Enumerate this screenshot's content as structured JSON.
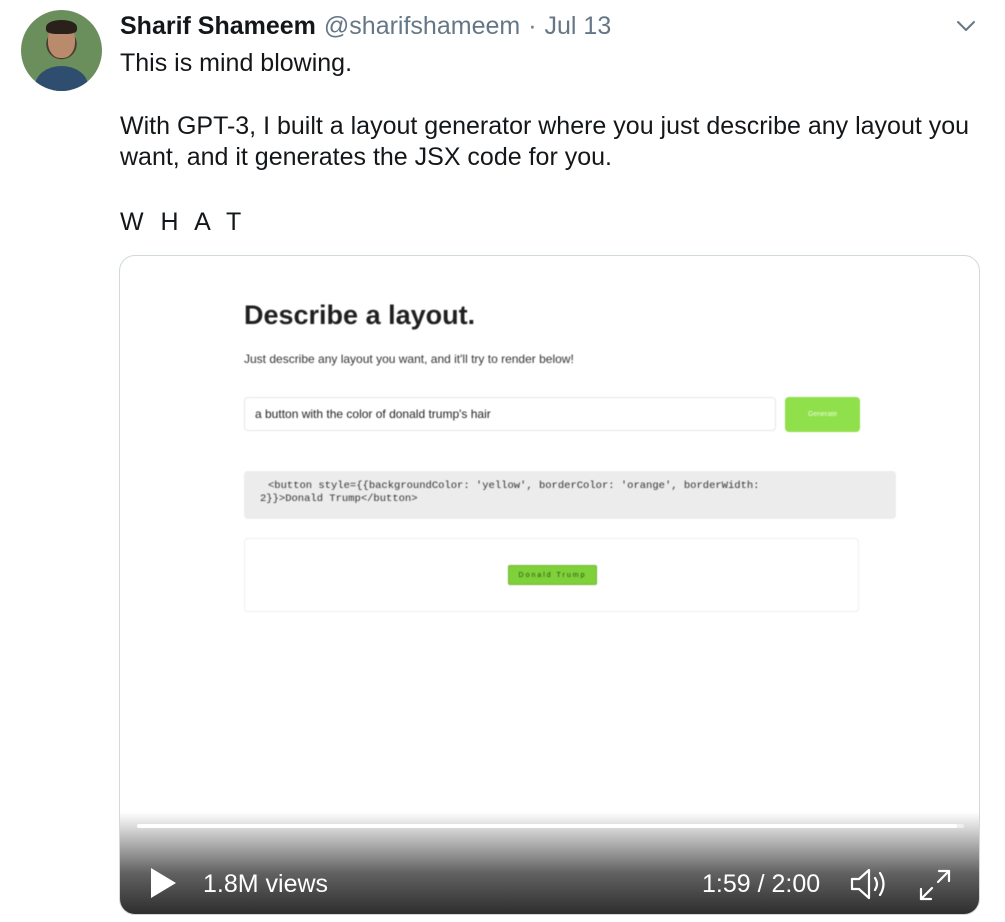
{
  "author": {
    "name": "Sharif Shameem",
    "handle": "@sharifshameem",
    "separator": "·",
    "date": "Jul 13"
  },
  "tweet": {
    "line1": "This is mind blowing.",
    "line2": "With GPT-3, I built a layout generator where you just describe any layout you want, and it generates the JSX code for you.",
    "line3": "W H A T"
  },
  "video": {
    "app": {
      "title": "Describe a layout.",
      "subtitle": "Just describe any layout you want, and it'll try to render below!",
      "input_value": "a button with the color of donald trump's hair",
      "button_label": "Generate",
      "code_line1": "<button style={{backgroundColor: 'yellow', borderColor: 'orange', borderWidth:",
      "code_line2": "2}}>Donald Trump</button>",
      "rendered_button_label": "Donald Trump",
      "button_color": "#8fe04a"
    },
    "views": "1.8M views",
    "time": "1:59 / 2:00",
    "progress": 0.992
  },
  "icons": [
    "caret-down-icon",
    "play-icon",
    "volume-icon",
    "fullscreen-icon"
  ],
  "colors": {
    "text_primary": "#14171a",
    "text_secondary": "#657786",
    "media_border": "#cfd9de"
  }
}
